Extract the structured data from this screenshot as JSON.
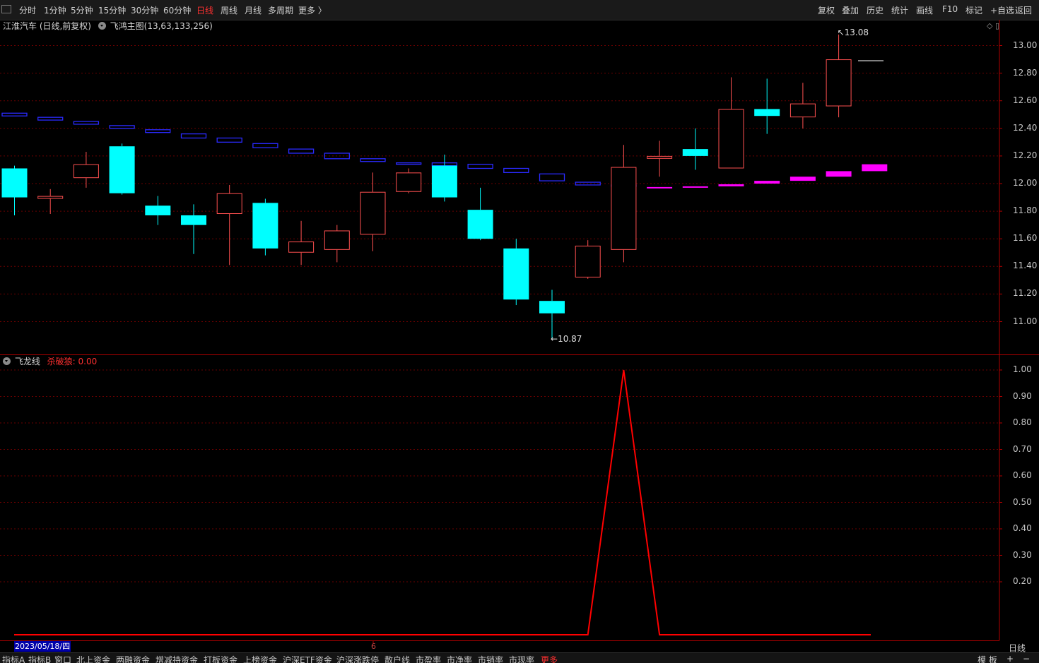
{
  "toolbar": {
    "periods": [
      "分时",
      "1分钟",
      "5分钟",
      "15分钟",
      "30分钟",
      "60分钟",
      "日线",
      "周线",
      "月线",
      "多周期",
      "更多 〉"
    ],
    "active_period": "日线",
    "tools": [
      "复权",
      "叠加",
      "历史",
      "统计",
      "画线",
      "F10",
      "标记",
      "+自选",
      "返回"
    ]
  },
  "main_chart": {
    "stock_title": "江淮汽车 (日线,前复权)",
    "indicator": "飞鸿主图(13,63,133,256)",
    "high_label": "13.08",
    "low_label": "10.87",
    "y_ticks": [
      "13.00",
      "12.80",
      "12.60",
      "12.40",
      "12.20",
      "12.00",
      "11.80",
      "11.60",
      "11.40",
      "11.20",
      "11.00"
    ]
  },
  "sub_chart": {
    "indicator_name": "飞龙线",
    "signal_label": "杀破狼: 0.00",
    "y_ticks": [
      "1.00",
      "0.90",
      "0.80",
      "0.70",
      "0.60",
      "0.50",
      "0.40",
      "0.30",
      "0.20"
    ]
  },
  "x_axis": {
    "date": "2023/05/18/四",
    "month_tick": "6",
    "period": "日线"
  },
  "bottom_tabs": [
    "指标A",
    "指标B",
    "窗口",
    "北上资金",
    "两融资金",
    "增减持资金",
    "打板资金",
    "上榜资金",
    "沪深ETF资金",
    "沪深涨跌停",
    "散户线",
    "市盈率",
    "市净率",
    "市销率",
    "市现率",
    "更多"
  ],
  "bottom_right": [
    "模 板",
    "+",
    "−"
  ],
  "colors": {
    "up": "#ff5050",
    "down": "#00ffff",
    "blue_band": "#2a2aff",
    "magenta_band": "#ff00ff",
    "signal_line": "#ff0000",
    "grid": "#6a0000"
  },
  "chart_data": [
    {
      "type": "candlestick",
      "title": "飞鸿主图(13,63,133,256)",
      "y_range": [
        10.87,
        13.08
      ],
      "ohlc": [
        {
          "o": 12.11,
          "h": 12.13,
          "l": 11.77,
          "c": 11.9
        },
        {
          "o": 11.89,
          "h": 11.96,
          "l": 11.78,
          "c": 11.91
        },
        {
          "o": 12.04,
          "h": 12.23,
          "l": 11.97,
          "c": 12.14
        },
        {
          "o": 12.27,
          "h": 12.29,
          "l": 11.92,
          "c": 11.93
        },
        {
          "o": 11.84,
          "h": 11.91,
          "l": 11.7,
          "c": 11.77
        },
        {
          "o": 11.77,
          "h": 11.85,
          "l": 11.49,
          "c": 11.7
        },
        {
          "o": 11.78,
          "h": 11.99,
          "l": 11.41,
          "c": 11.93
        },
        {
          "o": 11.86,
          "h": 11.89,
          "l": 11.48,
          "c": 11.53
        },
        {
          "o": 11.5,
          "h": 11.73,
          "l": 11.41,
          "c": 11.58
        },
        {
          "o": 11.52,
          "h": 11.7,
          "l": 11.43,
          "c": 11.66
        },
        {
          "o": 11.63,
          "h": 12.08,
          "l": 11.51,
          "c": 11.94
        },
        {
          "o": 11.94,
          "h": 12.11,
          "l": 11.93,
          "c": 12.08
        },
        {
          "o": 12.13,
          "h": 12.21,
          "l": 11.87,
          "c": 11.9
        },
        {
          "o": 11.81,
          "h": 11.97,
          "l": 11.59,
          "c": 11.6
        },
        {
          "o": 11.53,
          "h": 11.6,
          "l": 11.12,
          "c": 11.16
        },
        {
          "o": 11.15,
          "h": 11.23,
          "l": 10.87,
          "c": 11.06
        },
        {
          "o": 11.32,
          "h": 11.59,
          "l": 11.31,
          "c": 11.55
        },
        {
          "o": 11.52,
          "h": 12.28,
          "l": 11.43,
          "c": 12.12
        },
        {
          "o": 12.18,
          "h": 12.31,
          "l": 12.05,
          "c": 12.2
        },
        {
          "o": 12.25,
          "h": 12.4,
          "l": 12.1,
          "c": 12.2
        },
        {
          "o": 12.11,
          "h": 12.77,
          "l": 12.11,
          "c": 12.54
        },
        {
          "o": 12.54,
          "h": 12.76,
          "l": 12.36,
          "c": 12.49
        },
        {
          "o": 12.48,
          "h": 12.73,
          "l": 12.4,
          "c": 12.58
        },
        {
          "o": 12.56,
          "h": 13.08,
          "l": 12.48,
          "c": 12.9
        }
      ],
      "blue_band": [
        {
          "top": 12.51,
          "bottom": 12.49
        },
        {
          "top": 12.48,
          "bottom": 12.46
        },
        {
          "top": 12.45,
          "bottom": 12.43
        },
        {
          "top": 12.42,
          "bottom": 12.4
        },
        {
          "top": 12.39,
          "bottom": 12.37
        },
        {
          "top": 12.36,
          "bottom": 12.33
        },
        {
          "top": 12.33,
          "bottom": 12.3
        },
        {
          "top": 12.29,
          "bottom": 12.26
        },
        {
          "top": 12.25,
          "bottom": 12.22
        },
        {
          "top": 12.22,
          "bottom": 12.18
        },
        {
          "top": 12.18,
          "bottom": 12.16
        },
        {
          "top": 12.15,
          "bottom": 12.14
        },
        {
          "top": 12.15,
          "bottom": 12.13
        },
        {
          "top": 12.14,
          "bottom": 12.11
        },
        {
          "top": 12.11,
          "bottom": 12.08
        },
        {
          "top": 12.07,
          "bottom": 12.02
        },
        {
          "top": 12.01,
          "bottom": 11.99
        },
        {
          "top": 11.99,
          "bottom": 11.98
        }
      ],
      "magenta_band": [
        {
          "top": 11.975,
          "bottom": 11.97
        },
        {
          "top": 11.98,
          "bottom": 11.97
        },
        {
          "top": 11.995,
          "bottom": 11.98
        },
        {
          "top": 12.02,
          "bottom": 12.0
        },
        {
          "top": 12.05,
          "bottom": 12.02
        },
        {
          "top": 12.09,
          "bottom": 12.05
        },
        {
          "top": 12.14,
          "bottom": 12.09
        }
      ],
      "last_price_mark": 12.89
    },
    {
      "type": "line",
      "title": "飞龙线",
      "series": [
        {
          "name": "杀破狼",
          "values": [
            0,
            0,
            0,
            0,
            0,
            0,
            0,
            0,
            0,
            0,
            0,
            0,
            0,
            0,
            0,
            0,
            0,
            1,
            0,
            0,
            0,
            0,
            0,
            0,
            0
          ]
        }
      ],
      "ylim": [
        0,
        1.0
      ]
    }
  ]
}
